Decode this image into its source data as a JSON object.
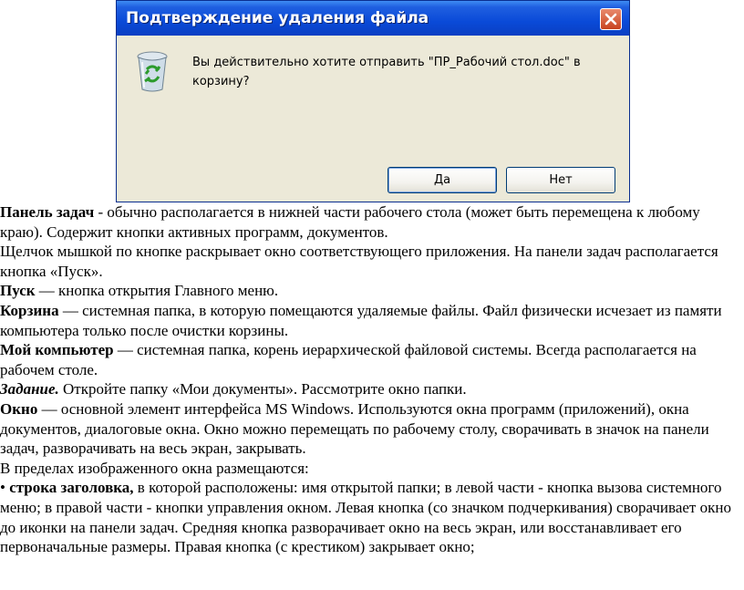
{
  "dialog": {
    "title": "Подтверждение удаления файла",
    "message": "Вы действительно хотите отправить \"ПР_Рабочий стол.doc\" в корзину?",
    "yes_label": "Да",
    "no_label": "Нет"
  },
  "doc": {
    "p1_term": "Панель задач",
    "p1_text": " - обычно располагается в нижней части рабочего стола (может быть перемещена к любому краю). Содержит кнопки активных программ, документов.",
    "p2_text": "Щелчок мышкой по кнопке раскрывает окно соответствующего приложения. На панели задач располагается кнопка «Пуск».",
    "p3_term": "Пуск",
    "p3_text": " — кнопка открытия Главного меню.",
    "p4_term": "Корзина",
    "p4_text": " — системная папка, в которую помещаются удаляемые файлы. Файл физически исчезает из памяти компьютера только после очистки корзины.",
    "p5_term": "Мой компьютер",
    "p5_text": " — системная папка, корень иерархической файловой системы. Всегда располагается на рабочем столе.",
    "p6_term": "Задание.",
    "p6_text": " Откройте папку «Мои документы». Рассмотрите окно папки.",
    "p7_term": "Окно",
    "p7_text": " — основной элемент интерфейса MS Windows. Используются окна программ (приложений), окна документов, диалоговые окна. Окно можно перемещать по рабочему столу, сворачивать в значок на панели задач, разворачивать на весь экран, закрывать.",
    "p8_text": "В пределах изображенного окна размещаются:",
    "p9_bullet": "•",
    "p9_term": "строка заголовка,",
    "p9_text": " в которой расположены: имя открытой папки; в левой части - кнопка вызова системного меню; в правой части - кнопки управления окном. Левая кнопка (со значком подчеркивания) сворачивает окно до иконки на панели задач. Средняя кнопка разворачивает окно на весь экран, или восстанавливает его первоначальные размеры. Правая кнопка (с крестиком) закрывает окно;"
  },
  "colors": {
    "titlebar": "#0a4ad8",
    "dialog_bg": "#ece9d8",
    "close_button": "#c8431f"
  },
  "icons": {
    "close": "close-icon",
    "recycle_bin": "recycle-bin-icon"
  }
}
